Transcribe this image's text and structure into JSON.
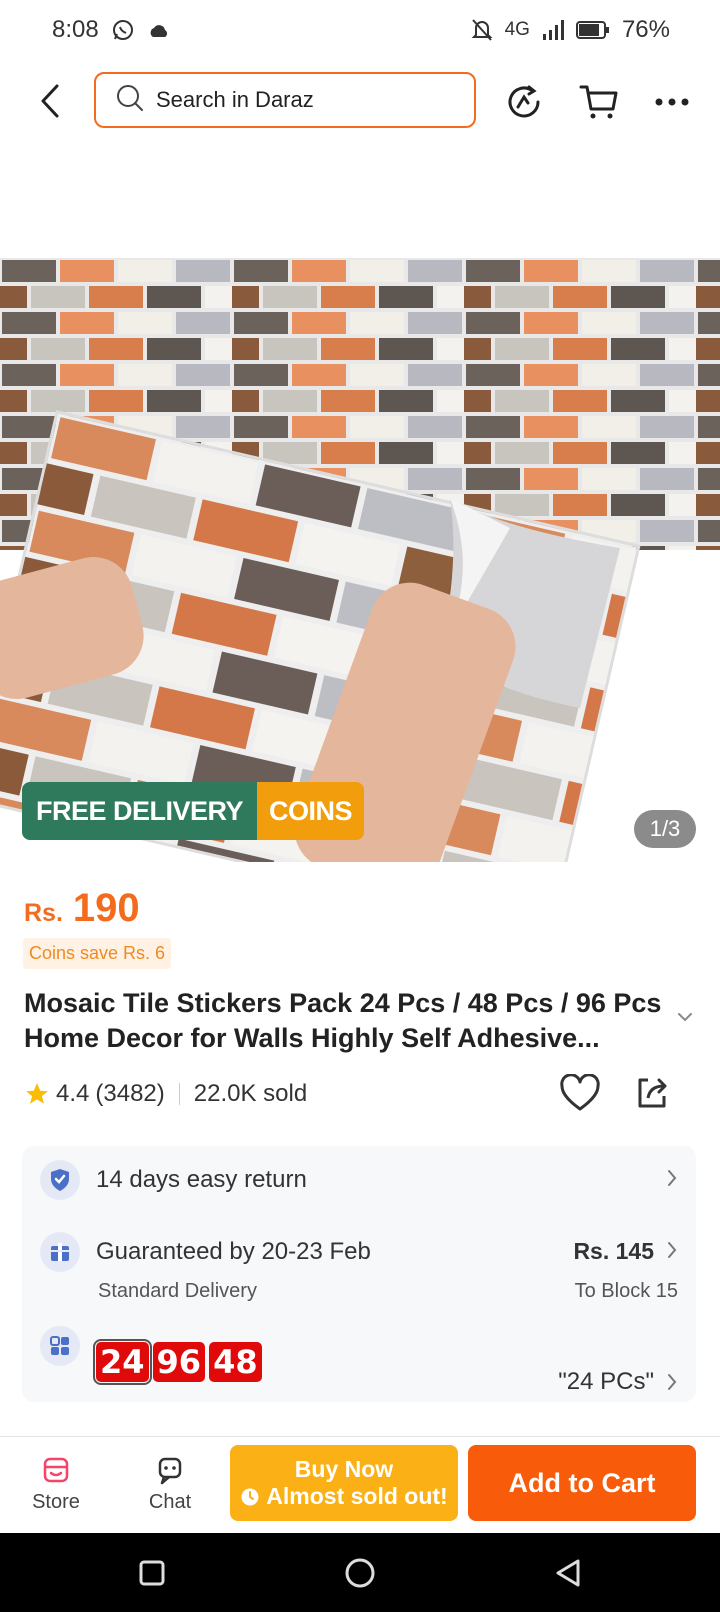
{
  "status_bar": {
    "time": "8:08",
    "network": "4G",
    "battery": "76%"
  },
  "search": {
    "placeholder": "Search in Daraz"
  },
  "gallery": {
    "counter": "1/3"
  },
  "promo": {
    "free_delivery": "FREE DELIVERY",
    "coins": "COINS"
  },
  "price": {
    "currency": "Rs.",
    "value": "190",
    "coins_save": "Coins save Rs. 6"
  },
  "product": {
    "title": "Mosaic Tile Stickers Pack 24 Pcs / 48 Pcs / 96 Pcs Home Decor for Walls Highly Self Adhesive...",
    "rating": "4.4",
    "reviews": "(3482)",
    "sold": "22.0K sold"
  },
  "info": {
    "return_text": "14 days easy return",
    "delivery_text": "Guaranteed by 20-23 Feb",
    "delivery_sub": "Standard Delivery",
    "delivery_price": "Rs. 145",
    "delivery_location": "To Block 15",
    "variants": [
      "24",
      "96",
      "48"
    ],
    "selected_variant": "\"24 PCs\""
  },
  "actions": {
    "store": "Store",
    "chat": "Chat",
    "buy_now": "Buy Now",
    "buy_now_sub": "Almost sold out!",
    "add_to_cart": "Add to Cart"
  },
  "colors": {
    "accent": "#f36b1c",
    "buy_now": "#fbb016",
    "add_to_cart": "#f85b0a",
    "promo_green": "#2f7a5c",
    "promo_orange": "#f29e0c",
    "chip_red": "#e10a0a"
  }
}
